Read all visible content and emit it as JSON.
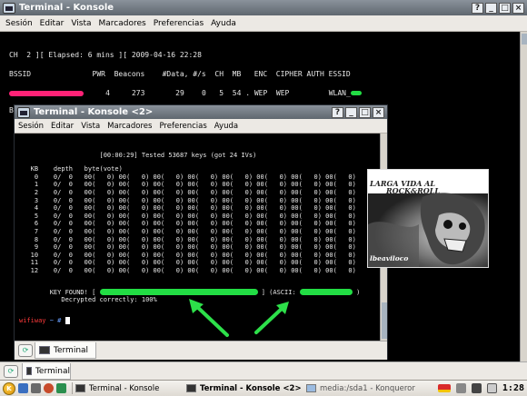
{
  "window_back": {
    "title": "Terminal - Konsole",
    "menu": [
      "Sesión",
      "Editar",
      "Vista",
      "Marcadores",
      "Preferencias",
      "Ayuda"
    ],
    "buttons": [
      "?",
      "_",
      "□",
      "×"
    ],
    "lines": {
      "status": "CH  2 ][ Elapsed: 6 mins ][ 2009-04-16 22:28",
      "ap_header": "BSSID              PWR  Beacons    #Data, #/s  CH  MB   ENC  CIPHER AUTH ESSID",
      "ap_row_tail": "     4     273       29    0   5  54 . WEP  WEP         WLAN_",
      "sta_header": "BSSID              STATION            PWR   Rate   Lost  Packets  Probe"
    },
    "tab_label": "Terminal"
  },
  "window_front": {
    "title": "Terminal - Konsole <2>",
    "menu": [
      "Sesión",
      "Editar",
      "Vista",
      "Marcadores",
      "Preferencias",
      "Ayuda"
    ],
    "buttons": [
      "?",
      "_",
      "□",
      "×"
    ],
    "lines": {
      "tested": "                     [00:00:29] Tested 53687 keys (got 24 IVs)",
      "kb_header": "   KB    depth   byte(vote)",
      "rows": [
        "    0    0/  0   00(   0) 00(   0) 00(   0) 00(   0) 00(   0) 00(   0) 00(   0) 00(   0)",
        "    1    0/  0   00(   0) 00(   0) 00(   0) 00(   0) 00(   0) 00(   0) 00(   0) 00(   0)",
        "    2    0/  0   00(   0) 00(   0) 00(   0) 00(   0) 00(   0) 00(   0) 00(   0) 00(   0)",
        "    3    0/  0   00(   0) 00(   0) 00(   0) 00(   0) 00(   0) 00(   0) 00(   0) 00(   0)",
        "    4    0/  0   00(   0) 00(   0) 00(   0) 00(   0) 00(   0) 00(   0) 00(   0) 00(   0)",
        "    5    0/  0   00(   0) 00(   0) 00(   0) 00(   0) 00(   0) 00(   0) 00(   0) 00(   0)",
        "    6    0/  0   00(   0) 00(   0) 00(   0) 00(   0) 00(   0) 00(   0) 00(   0) 00(   0)",
        "    7    0/  0   00(   0) 00(   0) 00(   0) 00(   0) 00(   0) 00(   0) 00(   0) 00(   0)",
        "    8    0/  0   00(   0) 00(   0) 00(   0) 00(   0) 00(   0) 00(   0) 00(   0) 00(   0)",
        "    9    0/  0   00(   0) 00(   0) 00(   0) 00(   0) 00(   0) 00(   0) 00(   0) 00(   0)",
        "   10    0/  0   00(   0) 00(   0) 00(   0) 00(   0) 00(   0) 00(   0) 00(   0) 00(   0)",
        "   11    0/  0   00(   0) 00(   0) 00(   0) 00(   0) 00(   0) 00(   0) 00(   0) 00(   0)",
        "   12    0/  0   00(   0) 00(   0) 00(   0) 00(   0) 00(   0) 00(   0) 00(   0) 00(   0)"
      ],
      "key_found_prefix": "        KEY FOUND! [ ",
      "key_found_mid": " ] (ASCII: ",
      "key_found_end": " )",
      "decrypted": "           Decrypted correctly: 100%",
      "prompt_host": "wifiway",
      "prompt_sep": " ~ # "
    },
    "tab_label": "Terminal"
  },
  "image": {
    "caption_top": "LARGA VIDA AL",
    "caption_top2": "ROCK&ROLL",
    "caption_bottom": "lbeaviloco"
  },
  "taskbar": {
    "items": [
      {
        "label": "Terminal - Konsole",
        "active": false
      },
      {
        "label": "Terminal - Konsole <2>",
        "active": true
      },
      {
        "label": "media:/sda1 - Konqueror",
        "active": false
      }
    ],
    "clock": "1:28",
    "colors": {
      "highlight_green": "#22dd44",
      "redaction_red": "#ff2277",
      "arrow_green": "#2de04a"
    }
  }
}
